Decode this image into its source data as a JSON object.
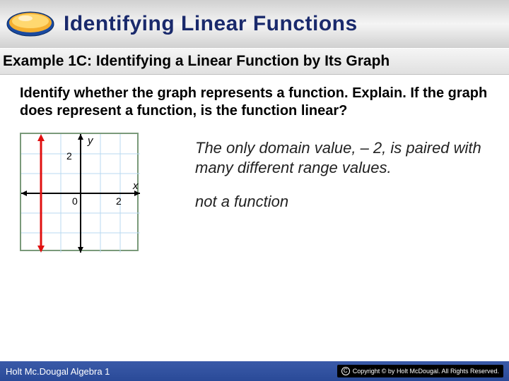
{
  "header": {
    "title": "Identifying Linear Functions"
  },
  "subhead": {
    "text": "Example 1C: Identifying a Linear Function by Its Graph"
  },
  "prompt": {
    "text": "Identify whether the graph represents a function. Explain. If the graph does represent a function, is the function linear?"
  },
  "graph": {
    "x_label": "x",
    "y_label": "y",
    "tick_x": "2",
    "tick_y": "2",
    "origin": "0",
    "vertical_line_x": -2
  },
  "explanation": {
    "line1": "The only domain value, – 2, is paired with many different range values.",
    "line2": "not a function"
  },
  "footer": {
    "left": "Holt Mc.Dougal Algebra 1",
    "right": "Copyright © by Holt McDougal. All Rights Reserved."
  },
  "chart_data": {
    "type": "line",
    "title": "",
    "xlabel": "x",
    "ylabel": "y",
    "xlim": [
      -3,
      3
    ],
    "ylim": [
      -3,
      3
    ],
    "series": [
      {
        "name": "vertical line",
        "x": [
          -2,
          -2
        ],
        "y": [
          -3,
          3
        ]
      }
    ],
    "ticks_x": [
      0,
      2
    ],
    "ticks_y": [
      0,
      2
    ]
  }
}
